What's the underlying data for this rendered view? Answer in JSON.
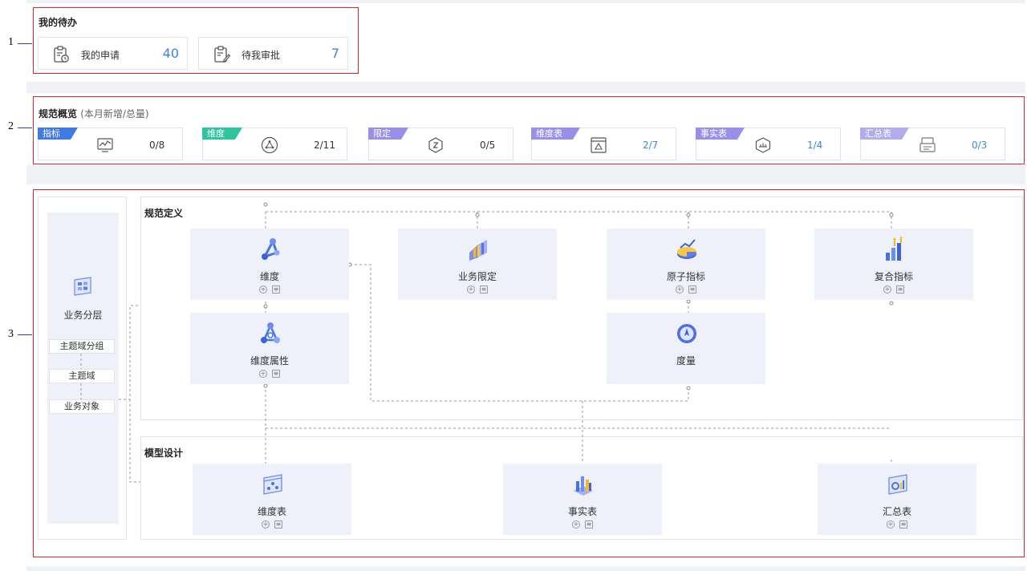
{
  "callouts": [
    "1",
    "2",
    "3"
  ],
  "todo": {
    "title": "我的待办",
    "items": [
      {
        "label": "我的申请",
        "count": "40",
        "icon": "clipboard-clock-icon"
      },
      {
        "label": "待我审批",
        "count": "7",
        "icon": "clipboard-edit-icon"
      }
    ]
  },
  "overview": {
    "title": "规范概览",
    "subtitle": "(本月新增/总量)",
    "cards": [
      {
        "tag": "指标",
        "tag_color": "#3e7ae6",
        "icon": "monitor-chart-icon",
        "count": "0/8",
        "count_color": "dark"
      },
      {
        "tag": "维度",
        "tag_color": "#2ec4a0",
        "icon": "dimension-circle-icon",
        "count": "2/11",
        "count_color": "dark"
      },
      {
        "tag": "限定",
        "tag_color": "#9a8fe8",
        "icon": "hexagon-limit-icon",
        "count": "0/5",
        "count_color": "dark"
      },
      {
        "tag": "维度表",
        "tag_color": "#9a8fe8",
        "icon": "dimension-table-icon",
        "count": "2/7",
        "count_color": "blue"
      },
      {
        "tag": "事实表",
        "tag_color": "#9a8fe8",
        "icon": "fact-table-icon",
        "count": "1/4",
        "count_color": "blue"
      },
      {
        "tag": "汇总表",
        "tag_color": "#b3acec",
        "icon": "summary-table-icon",
        "count": "0/3",
        "count_color": "blue"
      }
    ]
  },
  "flow": {
    "layer": {
      "title": "业务分层",
      "icon": "business-layer-icon",
      "steps": [
        "主题域分组",
        "主题域",
        "业务对象"
      ]
    },
    "definition": {
      "title": "规范定义",
      "nodes": [
        {
          "label": "维度",
          "icon": "dimension-icon"
        },
        {
          "label": "业务限定",
          "icon": "business-limit-icon"
        },
        {
          "label": "原子指标",
          "icon": "atomic-metric-icon"
        },
        {
          "label": "复合指标",
          "icon": "composite-metric-icon"
        },
        {
          "label": "维度属性",
          "icon": "dimension-attribute-icon"
        },
        {
          "label": "度量",
          "icon": "measure-icon"
        }
      ]
    },
    "model": {
      "title": "模型设计",
      "nodes": [
        {
          "label": "维度表",
          "icon": "dimension-table-model-icon"
        },
        {
          "label": "事实表",
          "icon": "fact-table-model-icon"
        },
        {
          "label": "汇总表",
          "icon": "summary-table-model-icon"
        }
      ]
    }
  }
}
